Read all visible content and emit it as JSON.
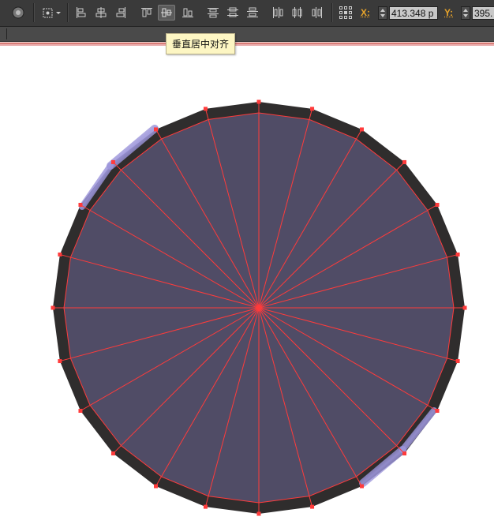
{
  "toolbar": {
    "tooltip": "垂直居中对齐",
    "x_label": "X:",
    "x_value": "413.348 p",
    "y_label": "Y:",
    "y_value": "395."
  },
  "colors": {
    "toolbar_bg": "#3a3a3a",
    "shape_fill": "#504c66",
    "shape_stroke": "#2f2d2d",
    "guide_red": "#ff3b3b",
    "accent_orange": "#e8a42a"
  },
  "icons": [
    "recolor-icon",
    "transform-reference-icon",
    "align-left-icon",
    "align-horizontal-center-icon",
    "align-right-icon",
    "align-top-icon",
    "align-vertical-center-icon",
    "align-bottom-icon",
    "distribute-top-icon",
    "distribute-vertical-center-icon",
    "distribute-bottom-icon",
    "distribute-left-icon",
    "distribute-horizontal-center-icon",
    "distribute-right-icon",
    "reference-point-icon"
  ]
}
